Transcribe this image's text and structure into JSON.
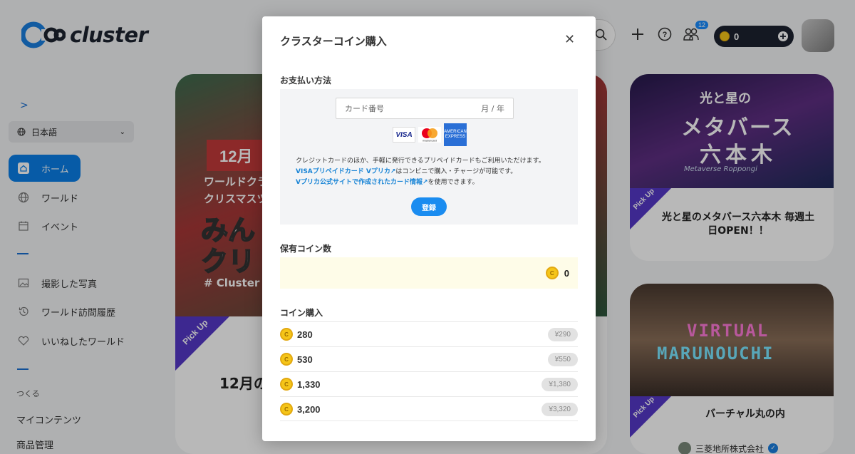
{
  "app": {
    "name": "cluster",
    "notification_count": "12",
    "coin_balance": "0"
  },
  "sidebar": {
    "language": "日本語",
    "items": [
      {
        "label": "ホーム"
      },
      {
        "label": "ワールド"
      },
      {
        "label": "イベント"
      },
      {
        "label": "撮影した写真"
      },
      {
        "label": "ワールド訪問履歴"
      },
      {
        "label": "いいねしたワールド"
      }
    ],
    "create_heading": "つくる",
    "my_content": "マイコンテンツ",
    "product_mgmt": "商品管理"
  },
  "cards": {
    "main": {
      "ribbon": "12月",
      "line1": "ワールドクラ",
      "line2": "クリスマスツ",
      "big1": "みん",
      "big2": "クリ",
      "line3": "# Cluster",
      "title": "12月の",
      "pickup": "Pick Up"
    },
    "right1": {
      "art1": "光と星の",
      "art2": "メタバース",
      "art3": "六本木",
      "art4": "Metaverse Roppongi",
      "title": "光と星のメタバース六本木 毎週土日OPEN！！",
      "pickup": "Pick Up"
    },
    "right2": {
      "art1": "VIRTUAL",
      "art2": "MARUNOUCHI",
      "title": "バーチャル丸の内",
      "org": "三菱地所株式会社",
      "pickup": "Pick Up"
    }
  },
  "modal": {
    "title": "クラスターコイン購入",
    "payment_heading": "お支払い方法",
    "card_placeholder": "カード番号",
    "expiry_placeholder": "月 / 年",
    "brands": [
      "VISA",
      "mastercard",
      "AMERICAN EXPRESS"
    ],
    "note_line1": "クレジットカードのほか、手軽に発行できるプリペイドカードもご利用いただけます。",
    "note_link1": "VISAプリペイドカード Vプリカ",
    "note_line2_rest": "はコンビニで購入・チャージが可能です。",
    "note_link2": "Vプリカ公式サイトで作成されたカード情報",
    "note_line3_rest": "を使用できます。",
    "register_label": "登録",
    "holding_heading": "保有コイン数",
    "holding_value": "0",
    "purchase_heading": "コイン購入",
    "packages": [
      {
        "coins": "280",
        "price": "¥290"
      },
      {
        "coins": "530",
        "price": "¥550"
      },
      {
        "coins": "1,330",
        "price": "¥1,380"
      },
      {
        "coins": "3,200",
        "price": "¥3,320"
      }
    ]
  },
  "colors": {
    "accent": "#1a8cf0",
    "active_nav": "#0a7fe8",
    "coin": "#f5c518",
    "pickup": "#5538c8"
  }
}
